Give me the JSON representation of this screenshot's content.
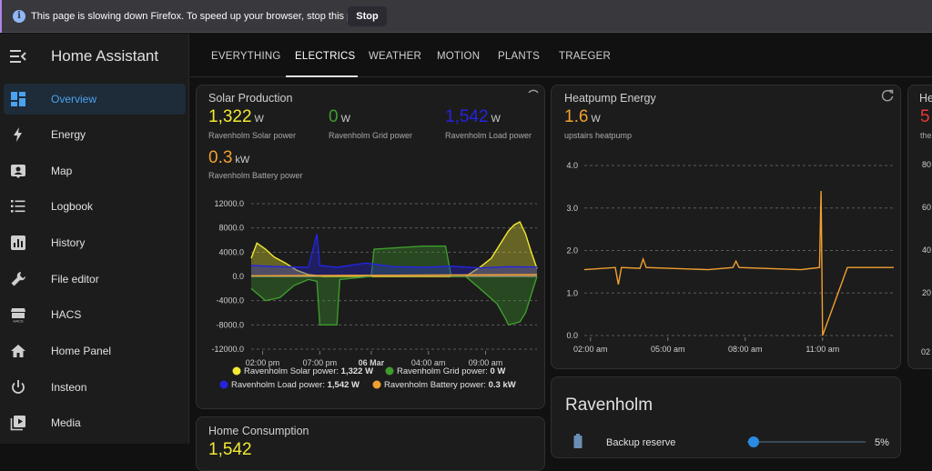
{
  "browser_notice": {
    "message": "This page is slowing down Firefox. To speed up your browser, stop this page.",
    "stop_label": "Stop"
  },
  "app": {
    "title": "Home Assistant"
  },
  "sidebar": {
    "items": [
      {
        "label": "Overview",
        "icon": "view-dashboard-icon",
        "active": true
      },
      {
        "label": "Energy",
        "icon": "lightning-bolt-icon"
      },
      {
        "label": "Map",
        "icon": "map-person-icon"
      },
      {
        "label": "Logbook",
        "icon": "list-icon"
      },
      {
        "label": "History",
        "icon": "chart-box-icon"
      },
      {
        "label": "File editor",
        "icon": "wrench-icon"
      },
      {
        "label": "HACS",
        "icon": "hacs-store-icon"
      },
      {
        "label": "Home Panel",
        "icon": "home-icon"
      },
      {
        "label": "Insteon",
        "icon": "power-icon"
      },
      {
        "label": "Media",
        "icon": "play-box-icon"
      }
    ]
  },
  "tabs": [
    "EVERYTHING",
    "ELECTRICS",
    "WEATHER",
    "MOTION",
    "PLANTS",
    "TRAEGER"
  ],
  "active_tab": "ELECTRICS",
  "solar_card": {
    "title": "Solar Production",
    "stats": [
      {
        "value": "1,322",
        "unit": "W",
        "label": "Ravenholm Solar power",
        "color": "#f2ea33"
      },
      {
        "value": "0",
        "unit": "W",
        "label": "Ravenholm Grid power",
        "color": "#3f9b2e"
      },
      {
        "value": "1,542",
        "unit": "W",
        "label": "Ravenholm Load power",
        "color": "#2424e0"
      },
      {
        "value": "0.3",
        "unit": "kW",
        "label": "Ravenholm Battery power",
        "color": "#f0a030"
      }
    ],
    "legend": [
      {
        "name": "Ravenholm Solar power:",
        "value": "1,322 W",
        "color": "#f2ea33"
      },
      {
        "name": "Ravenholm Grid power:",
        "value": "0 W",
        "color": "#3f9b2e"
      },
      {
        "name": "Ravenholm Load power:",
        "value": "1,542 W",
        "color": "#2424e0"
      },
      {
        "name": "Ravenholm Battery power:",
        "value": "0.3 kW",
        "color": "#f0a030"
      }
    ]
  },
  "heatpump_card": {
    "title": "Heatpump Energy",
    "value": "1.6",
    "unit": "W",
    "label": "upstairs heatpump",
    "color": "#f0a030"
  },
  "partial_card": {
    "title": "He",
    "value": "5",
    "label": "the",
    "y_ticks": [
      "80",
      "60",
      "40",
      "20"
    ],
    "x_tick": "02"
  },
  "home_consumption_card": {
    "title": "Home Consumption",
    "value": "1,542"
  },
  "ravenholm_card": {
    "title": "Ravenholm",
    "row_label": "Backup reserve",
    "row_value": "5%",
    "slider_fraction": 0.05
  },
  "chart_data": [
    {
      "type": "area",
      "title": "Solar Production",
      "y_ticks": [
        "12000.0",
        "8000.0",
        "4000.0",
        "0.0",
        "-4000.0",
        "-8000.0",
        "-12000.0"
      ],
      "ylim": [
        -12000,
        12000
      ],
      "x_ticks": [
        "02:00 pm",
        "07:00 pm",
        "06 Mar",
        "04:00 am",
        "09:00 am"
      ],
      "grid": true,
      "legend_position": "bottom",
      "series": [
        {
          "name": "Ravenholm Solar power",
          "color": "#f2ea33",
          "x": [
            0,
            0.02,
            0.05,
            0.08,
            0.12,
            0.16,
            0.2,
            0.25,
            0.75,
            0.8,
            0.84,
            0.86,
            0.88,
            0.9,
            0.92,
            0.94,
            0.96,
            0.98,
            1.0
          ],
          "values": [
            3000,
            5500,
            4500,
            3200,
            2200,
            1000,
            300,
            0,
            0,
            1500,
            3000,
            4500,
            6000,
            7500,
            8500,
            9000,
            7000,
            4000,
            1300
          ]
        },
        {
          "name": "Ravenholm Grid power",
          "color": "#3f9b2e",
          "x": [
            0,
            0.05,
            0.1,
            0.15,
            0.2,
            0.23,
            0.24,
            0.3,
            0.31,
            0.42,
            0.43,
            0.6,
            0.68,
            0.7,
            0.75,
            0.8,
            0.86,
            0.89,
            0.9,
            0.94,
            0.96,
            1.0
          ],
          "values": [
            -2000,
            -4000,
            -3500,
            -1500,
            -500,
            -800,
            -8000,
            -8000,
            -500,
            0,
            4500,
            5000,
            5000,
            0,
            0,
            -2000,
            -4500,
            -7000,
            -8000,
            -7500,
            -6000,
            0
          ]
        },
        {
          "name": "Ravenholm Load power",
          "color": "#2424e0",
          "x": [
            0,
            0.1,
            0.2,
            0.23,
            0.24,
            0.3,
            0.4,
            0.5,
            0.6,
            0.7,
            0.8,
            0.9,
            1.0
          ],
          "values": [
            1800,
            1600,
            1500,
            7000,
            1800,
            1500,
            2200,
            1600,
            1500,
            1700,
            1400,
            1600,
            1542
          ]
        },
        {
          "name": "Ravenholm Battery power",
          "color": "#f0a030",
          "x": [
            0,
            0.5,
            1.0
          ],
          "values": [
            100,
            200,
            300
          ]
        }
      ]
    },
    {
      "type": "line",
      "title": "Heatpump Energy",
      "y_ticks": [
        "4.0",
        "3.0",
        "2.0",
        "1.0",
        "0.0"
      ],
      "ylim": [
        0,
        4
      ],
      "x_ticks": [
        "02:00 am",
        "05:00 am",
        "08:00 am",
        "11:00 am"
      ],
      "grid": true,
      "series": [
        {
          "name": "upstairs heatpump",
          "color": "#f0a030",
          "x": [
            0,
            0.1,
            0.11,
            0.12,
            0.18,
            0.19,
            0.2,
            0.4,
            0.48,
            0.49,
            0.5,
            0.7,
            0.76,
            0.765,
            0.77,
            0.85,
            1.0
          ],
          "values": [
            1.55,
            1.6,
            1.2,
            1.6,
            1.58,
            1.8,
            1.6,
            1.55,
            1.6,
            1.75,
            1.6,
            1.55,
            1.6,
            3.4,
            0.0,
            1.6,
            1.6
          ]
        }
      ]
    }
  ]
}
